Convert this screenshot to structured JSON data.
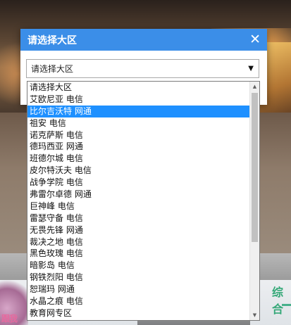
{
  "dialog": {
    "title": "请选择大区",
    "close_glyph": "✕",
    "select": {
      "value": "请选择大区",
      "arrow": "▼"
    }
  },
  "dropdown": {
    "selected_index": 2,
    "options": [
      "请选择大区",
      "艾欧尼亚 电信",
      "比尔吉沃特 网通",
      "祖安 电信",
      "诺克萨斯 电信",
      "德玛西亚 网通",
      "班德尔城 电信",
      "皮尔特沃夫 电信",
      "战争学院 电信",
      "弗雷尔卓德 网通",
      "巨神峰 电信",
      "雷瑟守备 电信",
      "无畏先锋 网通",
      "裁决之地 电信",
      "黑色玫瑰 电信",
      "暗影岛 电信",
      "钢铁烈阳 电信",
      "恕瑞玛 网通",
      "水晶之痕 电信",
      "教育网专区"
    ],
    "scroll": {
      "up": "▲",
      "down": "▼"
    }
  },
  "background": {
    "pink_text": "跟我",
    "green_text": "综合"
  },
  "colors": {
    "header": "#3b8ee8",
    "selection": "#1e90ff"
  }
}
